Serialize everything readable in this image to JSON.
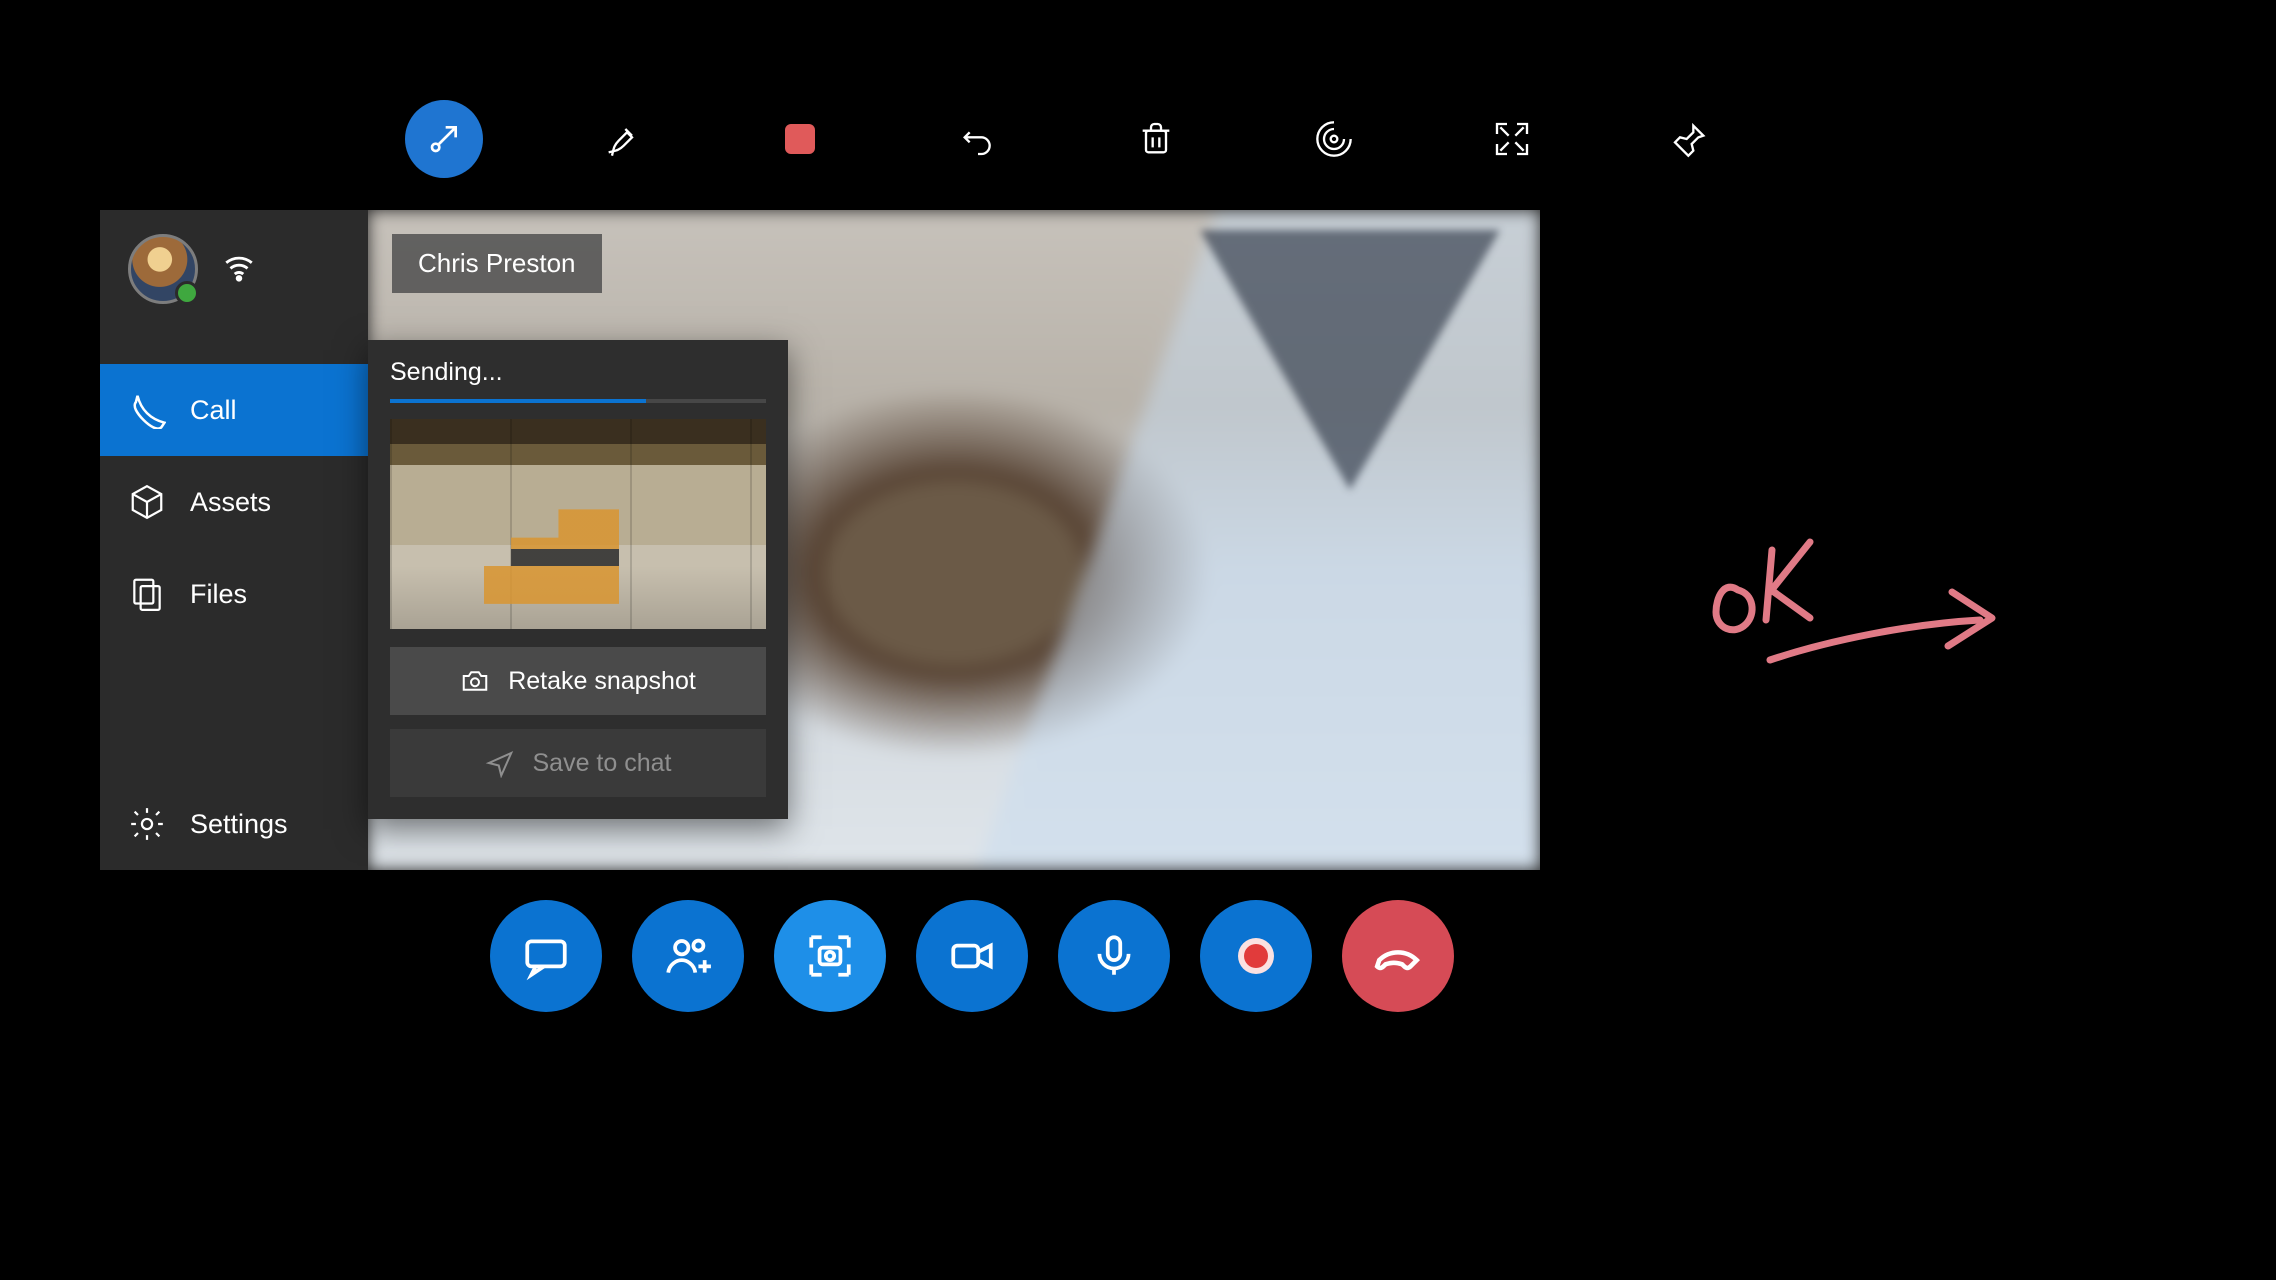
{
  "toolbar": {
    "items": [
      "minimize",
      "pen",
      "stop",
      "undo",
      "delete",
      "target",
      "fullscreen",
      "pin"
    ]
  },
  "sidebar": {
    "nav": {
      "call": "Call",
      "assets": "Assets",
      "files": "Files",
      "settings": "Settings"
    },
    "active": "call"
  },
  "video": {
    "participant_name": "Chris Preston"
  },
  "snapshot_panel": {
    "title": "Sending...",
    "progress_pct": 68,
    "retake_label": "Retake snapshot",
    "save_label": "Save to chat",
    "save_enabled": false
  },
  "callbar": {
    "buttons": [
      "chat",
      "add-people",
      "snapshot",
      "video",
      "mic",
      "record",
      "end-call"
    ]
  },
  "annotation": {
    "text": "OK"
  },
  "colors": {
    "accent": "#0b73d1",
    "accent_light": "#1e8fe8",
    "danger": "#d64b56",
    "record": "#e13b3b",
    "ink": "#e07a86"
  }
}
